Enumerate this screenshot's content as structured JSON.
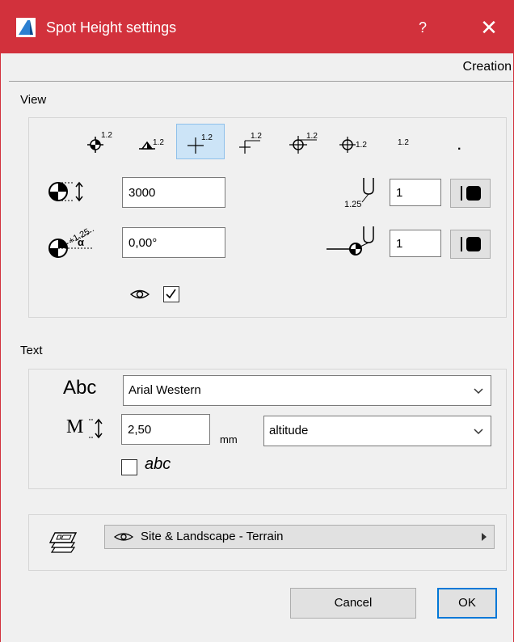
{
  "window": {
    "title": "Spot Height settings",
    "help": "?",
    "close": "✕",
    "accent": "#d2313c",
    "tab": "Creation"
  },
  "view": {
    "section_label": "View",
    "marker_styles": [
      {
        "name": "marker-style-1",
        "label": "1.2"
      },
      {
        "name": "marker-style-2",
        "label": "1.2"
      },
      {
        "name": "marker-style-3",
        "label": "1.2",
        "selected": true
      },
      {
        "name": "marker-style-4",
        "label": "1.2"
      },
      {
        "name": "marker-style-5",
        "label": "1.2"
      },
      {
        "name": "marker-style-6",
        "label": "1.2"
      },
      {
        "name": "marker-style-7",
        "label": "1.2"
      },
      {
        "name": "marker-style-8",
        "label": "."
      }
    ],
    "marker_size": "3000",
    "marker_angle": "0,00°",
    "text_pen": "1",
    "marker_pen": "1",
    "text_pen_icon_label": "1.25",
    "angle_icon_label": "+1.25",
    "visible_checked": true
  },
  "text": {
    "section_label": "Text",
    "font_icon_label": "Abc",
    "font": "Arial Western",
    "size_icon_label": "M",
    "size": "2,50",
    "unit": "mm",
    "style": "altitude",
    "italic_icon_label": "abc",
    "italic_checked": false
  },
  "layer": {
    "value": "Site & Landscape - Terrain"
  },
  "buttons": {
    "cancel": "Cancel",
    "ok": "OK"
  }
}
